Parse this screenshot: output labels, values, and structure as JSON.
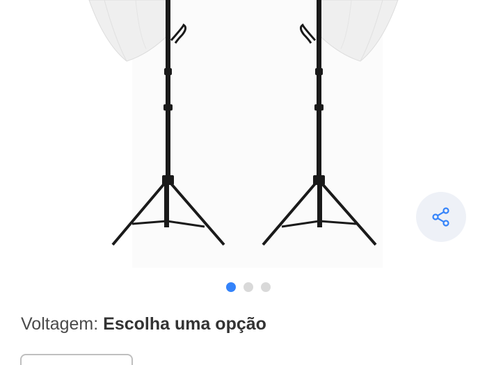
{
  "product": {
    "image_alt": "Kit de iluminação com dois tripés e sombrinhas difusoras brancas"
  },
  "share": {
    "icon": "share-icon",
    "bg_color": "#eef1f7",
    "icon_color": "#3483fa"
  },
  "carousel": {
    "total": 3,
    "active_index": 0,
    "active_color": "#3483fa"
  },
  "variation": {
    "label": "Voltagem:",
    "value": "Escolha uma opção"
  }
}
